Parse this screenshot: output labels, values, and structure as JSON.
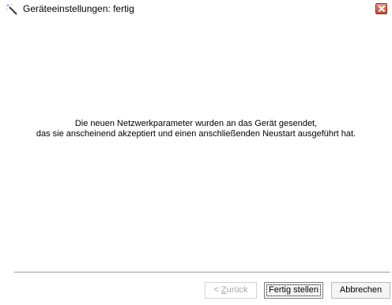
{
  "window": {
    "title": "Geräteeinstellungen: fertig",
    "title_icon": "wizard-wand-icon",
    "close_icon": "close-icon"
  },
  "message": {
    "line1": "Die neuen Netzwerkparameter wurden an das Gerät gesendet,",
    "line2": "das sie anscheinend akzeptiert und einen anschließenden Neustart ausgeführt hat."
  },
  "buttons": {
    "back_prefix": "< ",
    "back_mnemonic": "Z",
    "back_rest": "urück",
    "back_enabled": false,
    "finish_label": "Fertig stellen",
    "cancel_label": "Abbrechen"
  },
  "colors": {
    "close_button": "#c24a35",
    "disabled_text": "#a8a8a8"
  }
}
